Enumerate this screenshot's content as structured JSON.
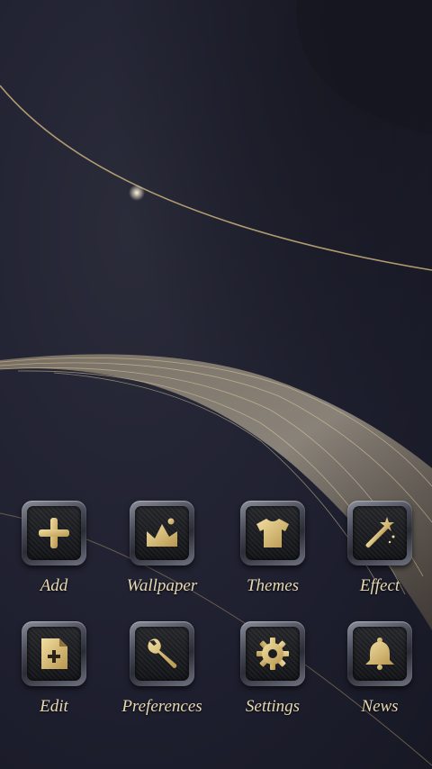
{
  "theme": {
    "accent_gold": "#d8bf82",
    "background": "#1f2030",
    "label_color": "#e7d9b2"
  },
  "launcher": {
    "icons": [
      {
        "label": "Add",
        "icon": "plus-icon"
      },
      {
        "label": "Wallpaper",
        "icon": "picture-icon"
      },
      {
        "label": "Themes",
        "icon": "tshirt-icon"
      },
      {
        "label": "Effect",
        "icon": "magic-wand-icon"
      },
      {
        "label": "Edit",
        "icon": "add-document-icon"
      },
      {
        "label": "Preferences",
        "icon": "wrench-icon"
      },
      {
        "label": "Settings",
        "icon": "gear-icon"
      },
      {
        "label": "News",
        "icon": "bell-icon"
      }
    ]
  }
}
